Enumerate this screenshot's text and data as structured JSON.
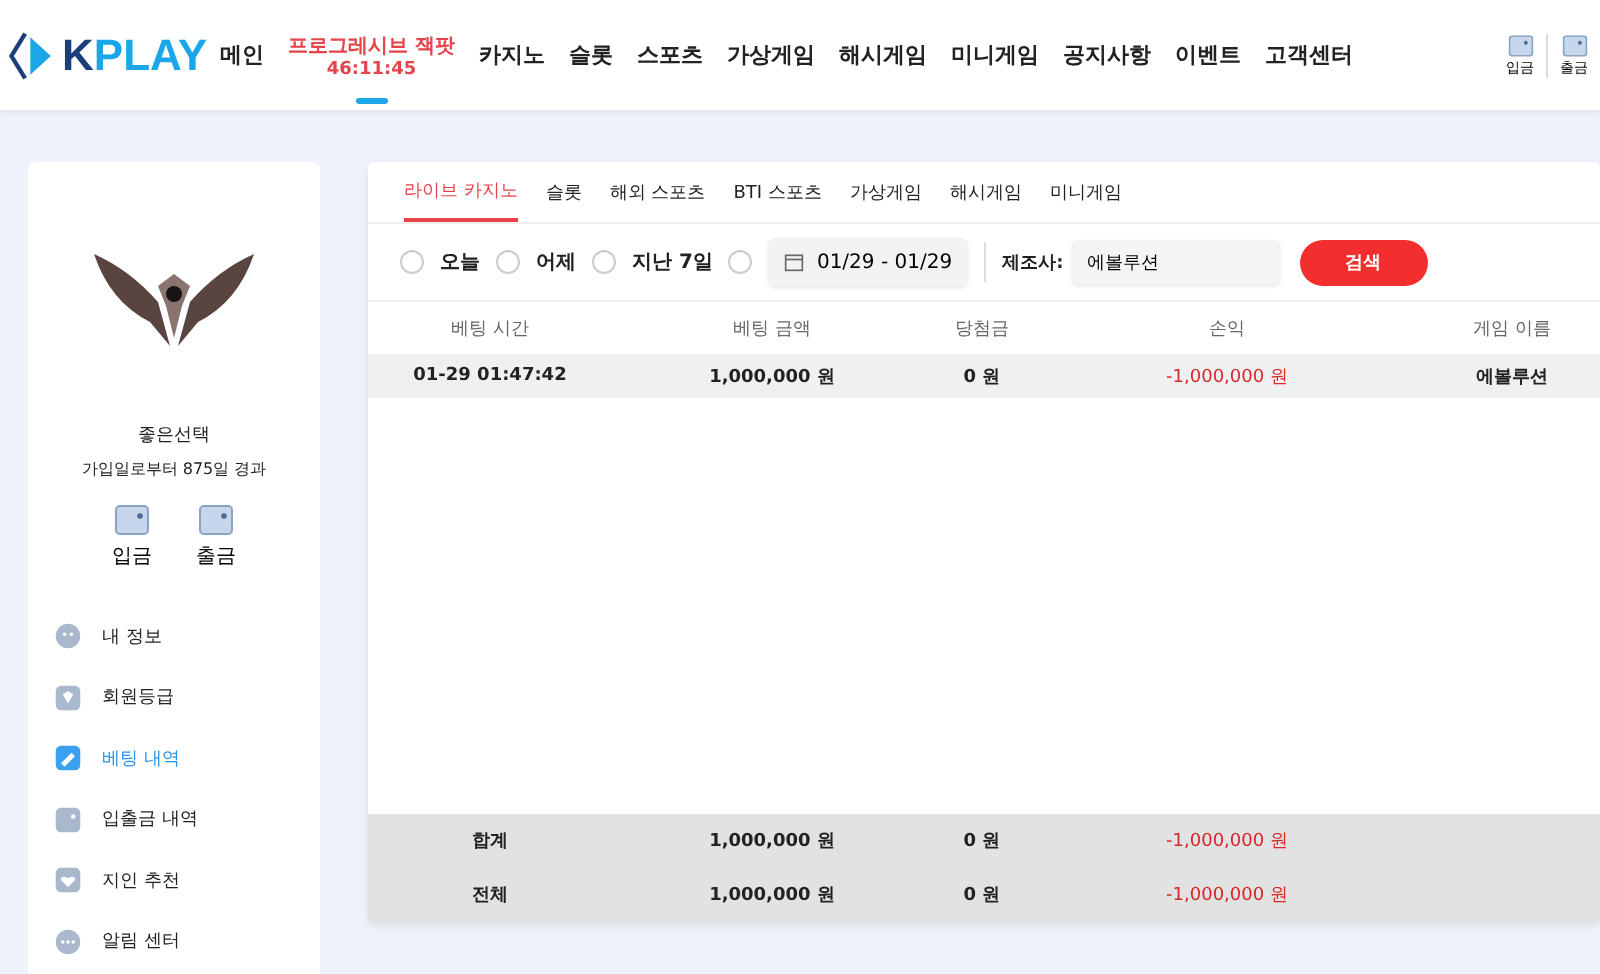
{
  "header": {
    "logo_parts": [
      "K",
      "PLAY"
    ],
    "nav": [
      {
        "label": "메인",
        "selected": false
      },
      {
        "label": "프로그레시브 잭팟",
        "sub": "46:11:45",
        "selected": true
      },
      {
        "label": "카지노",
        "selected": false
      },
      {
        "label": "슬롯",
        "selected": false
      },
      {
        "label": "스포츠",
        "selected": false
      },
      {
        "label": "가상게임",
        "selected": false
      },
      {
        "label": "해시게임",
        "selected": false
      },
      {
        "label": "미니게임",
        "selected": false
      },
      {
        "label": "공지사항",
        "selected": false
      },
      {
        "label": "이벤트",
        "selected": false
      },
      {
        "label": "고객센터",
        "selected": false
      }
    ],
    "actions": [
      "입금",
      "출금"
    ]
  },
  "sidebar": {
    "username": "좋은선택",
    "joined": "가입일로부터 875일 경과",
    "wallet": [
      "입금",
      "출금"
    ],
    "menu": [
      {
        "label": "내 정보",
        "selected": false
      },
      {
        "label": "회원등급",
        "selected": false
      },
      {
        "label": "베팅 내역",
        "selected": true
      },
      {
        "label": "입출금 내역",
        "selected": false
      },
      {
        "label": "지인 추천",
        "selected": false
      },
      {
        "label": "알림 센터",
        "selected": false
      }
    ]
  },
  "tabs": [
    {
      "label": "라이브 카지노",
      "selected": true
    },
    {
      "label": "슬롯",
      "selected": false
    },
    {
      "label": "해외 스포츠",
      "selected": false
    },
    {
      "label": "BTI 스포츠",
      "selected": false
    },
    {
      "label": "가상게임",
      "selected": false
    },
    {
      "label": "해시게임",
      "selected": false
    },
    {
      "label": "미니게임",
      "selected": false
    }
  ],
  "filters": {
    "periods": [
      {
        "label": "오늘",
        "selected": false
      },
      {
        "label": "어제",
        "selected": false
      },
      {
        "label": "지난 7일",
        "selected": false
      },
      {
        "selected": false
      }
    ],
    "date_range": "01/29 - 01/29",
    "provider_label": "제조사:",
    "provider_value": "에볼루션",
    "search_button": "검색"
  },
  "table": {
    "columns": [
      "베팅 시간",
      "베팅 금액",
      "당첨금",
      "손익",
      "게임 이름"
    ],
    "rows": [
      [
        "01-29 01:47:42",
        "1,000,000 원",
        "0 원",
        "-1,000,000 원",
        "에볼루션"
      ]
    ],
    "totals": [
      [
        "합계",
        "1,000,000 원",
        "0 원",
        "-1,000,000 원"
      ],
      [
        "전체",
        "1,000,000 원",
        "0 원",
        "-1,000,000 원"
      ]
    ]
  }
}
